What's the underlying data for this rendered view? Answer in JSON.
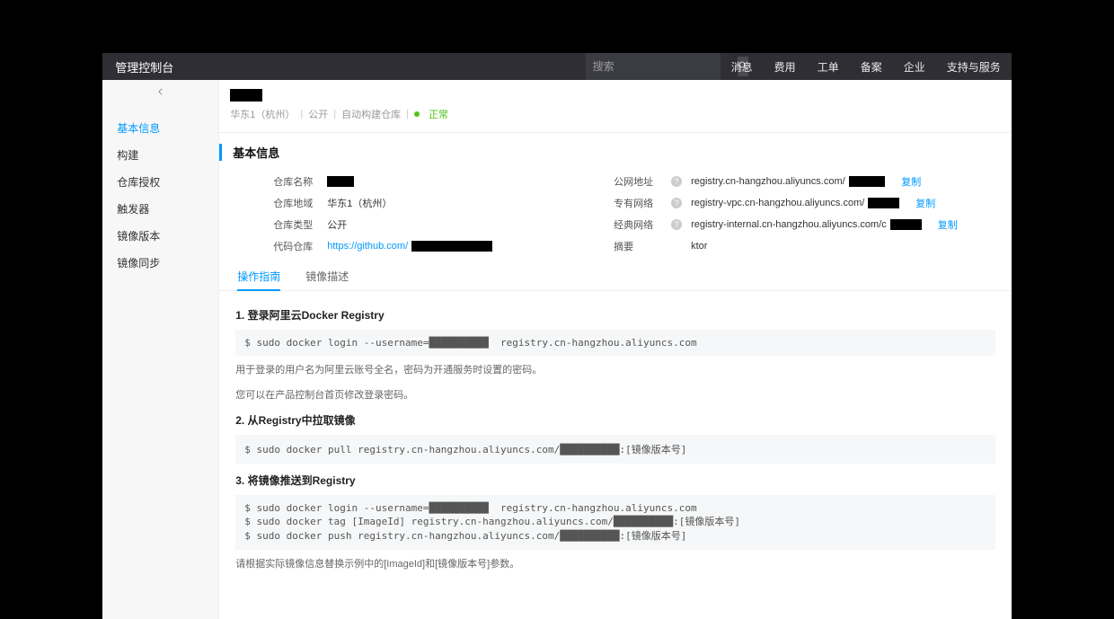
{
  "topbar": {
    "title": "管理控制台",
    "search_placeholder": "搜索",
    "nav": [
      "消息",
      "费用",
      "工单",
      "备案",
      "企业",
      "支持与服务"
    ]
  },
  "sidebar": {
    "items": [
      {
        "label": "基本信息",
        "active": true
      },
      {
        "label": "构建"
      },
      {
        "label": "仓库授权"
      },
      {
        "label": "触发器"
      },
      {
        "label": "镜像版本"
      },
      {
        "label": "镜像同步"
      }
    ]
  },
  "breadcrumb": {
    "region": "华东1（杭州）",
    "visibility": "公开",
    "kind": "自动构建仓库",
    "status": "正常"
  },
  "section_title": "基本信息",
  "info": {
    "left": {
      "repo_name_label": "仓库名称",
      "region_label": "仓库地域",
      "region_value": "华东1（杭州）",
      "type_label": "仓库类型",
      "type_value": "公开",
      "code_repo_label": "代码仓库",
      "code_repo_value": "https://github.com/"
    },
    "right": {
      "public_label": "公网地址",
      "public_value": "registry.cn-hangzhou.aliyuncs.com/",
      "vpc_label": "专有网络",
      "vpc_value": "registry-vpc.cn-hangzhou.aliyuncs.com/",
      "internal_label": "经典网络",
      "internal_value": "registry-internal.cn-hangzhou.aliyuncs.com/c",
      "summary_label": "摘要",
      "summary_value": "ktor",
      "copy": "复制"
    }
  },
  "tabs": {
    "guide": "操作指南",
    "desc": "镜像描述"
  },
  "guide": {
    "step1": {
      "title": "1. 登录阿里云Docker Registry",
      "cmd": "$ sudo docker login --username=██████████  registry.cn-hangzhou.aliyuncs.com",
      "help1": "用于登录的用户名为阿里云账号全名，密码为开通服务时设置的密码。",
      "help2": "您可以在产品控制台首页修改登录密码。"
    },
    "step2": {
      "title": "2. 从Registry中拉取镜像",
      "cmd": "$ sudo docker pull registry.cn-hangzhou.aliyuncs.com/██████████:[镜像版本号]"
    },
    "step3": {
      "title": "3. 将镜像推送到Registry",
      "cmd": "$ sudo docker login --username=██████████  registry.cn-hangzhou.aliyuncs.com\n$ sudo docker tag [ImageId] registry.cn-hangzhou.aliyuncs.com/██████████:[镜像版本号]\n$ sudo docker push registry.cn-hangzhou.aliyuncs.com/██████████:[镜像版本号]",
      "help": "请根据实际镜像信息替换示例中的[ImageId]和[镜像版本号]参数。"
    }
  }
}
